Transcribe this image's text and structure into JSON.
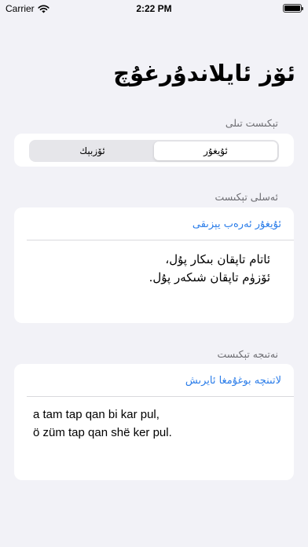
{
  "status_bar": {
    "carrier": "Carrier",
    "time": "2:22 PM"
  },
  "title": "ئۆز ئايلاندۇرغۇچ",
  "language_section": {
    "header": "تېكىست تىلى",
    "options": [
      {
        "label": "ئۇيغۇر",
        "selected": true
      },
      {
        "label": "ئۆزبېك",
        "selected": false
      }
    ]
  },
  "source_section": {
    "header": "ئەسلى تېكىست",
    "action": "ئۇيغۇر ئەرەب يېزىقى",
    "text_lines": [
      "ئاتام تاپقان بىكار پۇل،",
      "ئۆزۈم تاپقان شىكەر پۇل."
    ]
  },
  "result_section": {
    "header": "نەتىجە تېكىست",
    "action": "لاتىنچە بوغۇمغا ئايرىش",
    "text_lines": [
      "a tam tap qan bi kar pul,",
      "ö züm tap qan shë ker pul."
    ]
  },
  "colors": {
    "background": "#f2f2f7",
    "accent": "#2b7de9",
    "secondary_text": "#6d6d72"
  }
}
